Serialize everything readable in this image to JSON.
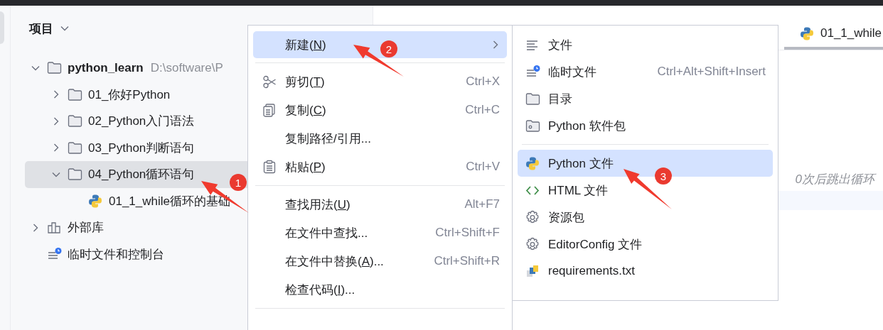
{
  "project_panel": {
    "title": "项目",
    "tree": [
      {
        "label": "python_learn",
        "path": "D:\\software\\P",
        "kind": "folder",
        "expanded": true,
        "selected": false,
        "children": [
          {
            "label": "01_你好Python",
            "kind": "folder",
            "expanded": false,
            "selected": false
          },
          {
            "label": "02_Python入门语法",
            "kind": "folder",
            "expanded": false,
            "selected": false
          },
          {
            "label": "03_Python判断语句",
            "kind": "folder",
            "expanded": false,
            "selected": false
          },
          {
            "label": "04_Python循环语句",
            "kind": "folder",
            "expanded": true,
            "selected": true,
            "children": [
              {
                "label": "01_1_while循环的基础",
                "kind": "python",
                "selected": false
              }
            ]
          }
        ]
      },
      {
        "label": "外部库",
        "kind": "library",
        "expanded": false,
        "selected": false
      },
      {
        "label": "临时文件和控制台",
        "kind": "scratch",
        "selected": false
      }
    ]
  },
  "editor": {
    "tabs": [
      {
        "label": "01_1_while",
        "selected": true
      }
    ],
    "lines": [
      {
        "text": "0次后跳出循环",
        "kind": "comment"
      },
      {
        "kind": "current"
      }
    ]
  },
  "context_menu": {
    "items": [
      {
        "kind": "plain",
        "label": "新建(",
        "mnemonic": "N",
        "suffix": ")",
        "submenu": true,
        "selected": true
      },
      {
        "kind": "separator"
      },
      {
        "kind": "scissors",
        "label": "剪切(",
        "mnemonic": "T",
        "suffix": ")",
        "shortcut": "Ctrl+X",
        "selected": false
      },
      {
        "kind": "copy",
        "label": "复制(",
        "mnemonic": "C",
        "suffix": ")",
        "shortcut": "Ctrl+C",
        "selected": false
      },
      {
        "kind": "plain",
        "label": "复制路径/引用...",
        "selected": false
      },
      {
        "kind": "paste",
        "label": "粘贴(",
        "mnemonic": "P",
        "suffix": ")",
        "shortcut": "Ctrl+V",
        "selected": false
      },
      {
        "kind": "separator"
      },
      {
        "kind": "plain",
        "label": "查找用法(",
        "mnemonic": "U",
        "suffix": ")",
        "shortcut": "Alt+F7",
        "selected": false
      },
      {
        "kind": "plain",
        "label": "在文件中查找...",
        "shortcut": "Ctrl+Shift+F",
        "selected": false
      },
      {
        "kind": "plain",
        "label": "在文件中替换(",
        "mnemonic": "A",
        "suffix": ")...",
        "shortcut": "Ctrl+Shift+R",
        "selected": false
      },
      {
        "kind": "plain",
        "label": "检查代码(",
        "mnemonic": "I",
        "suffix": ")...",
        "selected": false
      },
      {
        "kind": "separator"
      }
    ]
  },
  "submenu": {
    "items": [
      {
        "kind": "lines",
        "label": "文件",
        "selected": false
      },
      {
        "kind": "scratch",
        "label": "临时文件",
        "shortcut": "Ctrl+Alt+Shift+Insert",
        "selected": false
      },
      {
        "kind": "folder",
        "label": "目录",
        "selected": false
      },
      {
        "kind": "package",
        "label": "Python 软件包",
        "selected": false
      },
      {
        "kind": "separator"
      },
      {
        "kind": "python",
        "label": "Python 文件",
        "selected": true
      },
      {
        "kind": "html",
        "label": "HTML 文件",
        "selected": false
      },
      {
        "kind": "gear",
        "label": "资源包",
        "selected": false
      },
      {
        "kind": "gear",
        "label": "EditorConfig 文件",
        "selected": false
      },
      {
        "kind": "requirements",
        "label": "requirements.txt",
        "selected": false
      }
    ]
  },
  "annotations": [
    {
      "label": "1"
    },
    {
      "label": "2"
    },
    {
      "label": "3"
    }
  ]
}
